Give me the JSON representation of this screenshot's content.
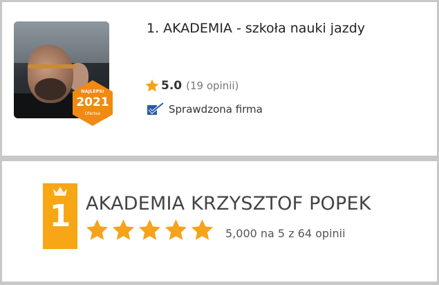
{
  "listing_primary": {
    "title": "1. AKADEMIA - szkoła nauki jazdy",
    "badge": {
      "top_text": "NAJLEPSI",
      "year": "2021",
      "bottom_text": "Oferteo"
    },
    "rating_score": "5.0",
    "rating_count": "(19 opinii)",
    "verified_label": "Sprawdzona firma"
  },
  "listing_secondary": {
    "rank": "1",
    "title": "AKADEMIA KRZYSZTOF POPEK",
    "stars_filled": 5,
    "stars_total": 5,
    "rating_text": "5,000 na 5 z 64 opinii"
  },
  "colors": {
    "star": "#f5a31a",
    "badge": "#f08a13",
    "rank_box": "#f7a615",
    "verified_icon": "#2a5aa8"
  }
}
